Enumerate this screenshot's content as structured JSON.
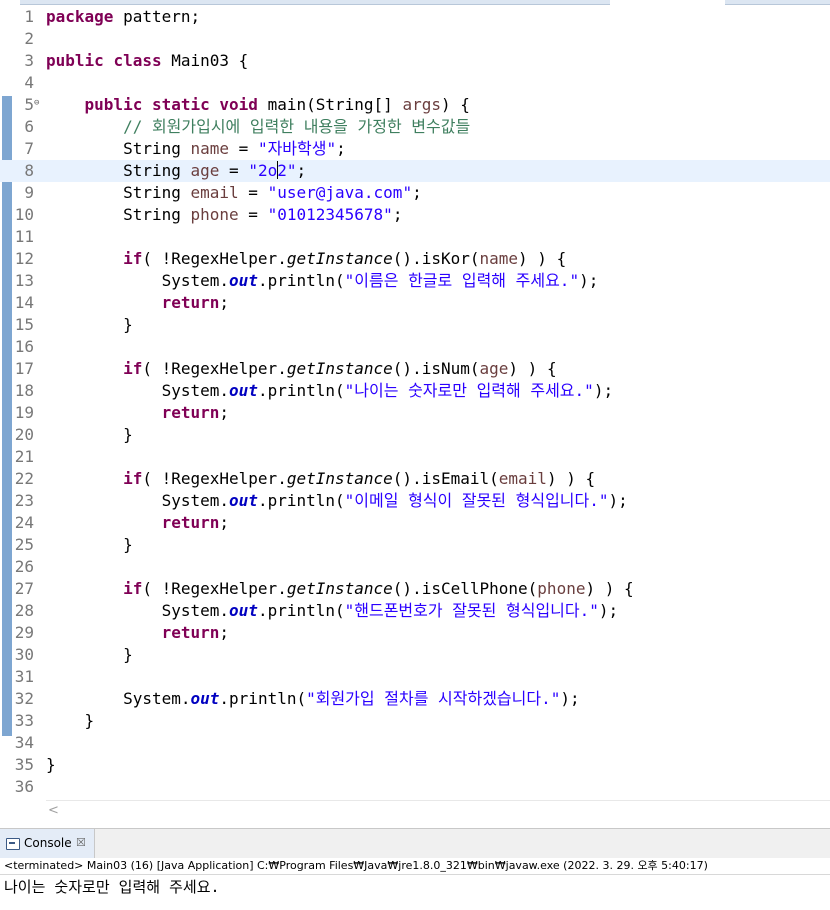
{
  "editor": {
    "current_line": 8,
    "lines": [
      {
        "n": "1",
        "tokens": [
          {
            "t": "package",
            "c": "kw"
          },
          {
            "t": " pattern;"
          }
        ]
      },
      {
        "n": "2",
        "tokens": []
      },
      {
        "n": "3",
        "tokens": [
          {
            "t": "public",
            "c": "kw"
          },
          {
            "t": " "
          },
          {
            "t": "class",
            "c": "kw"
          },
          {
            "t": " Main03 {"
          }
        ]
      },
      {
        "n": "4",
        "tokens": []
      },
      {
        "n": "5",
        "fold": "⊖",
        "tokens": [
          {
            "t": "    "
          },
          {
            "t": "public",
            "c": "kw"
          },
          {
            "t": " "
          },
          {
            "t": "static",
            "c": "kw"
          },
          {
            "t": " "
          },
          {
            "t": "void",
            "c": "kw"
          },
          {
            "t": " main(String[] "
          },
          {
            "t": "args",
            "c": "var"
          },
          {
            "t": ") {"
          }
        ]
      },
      {
        "n": "6",
        "tokens": [
          {
            "t": "        "
          },
          {
            "t": "// 회원가입시에 입력한 내용을 가정한 변수값들",
            "c": "cm"
          }
        ]
      },
      {
        "n": "7",
        "tokens": [
          {
            "t": "        String "
          },
          {
            "t": "name",
            "c": "var"
          },
          {
            "t": " = "
          },
          {
            "t": "\"자바학생\"",
            "c": "str"
          },
          {
            "t": ";"
          }
        ]
      },
      {
        "n": "8",
        "tokens": [
          {
            "t": "        String "
          },
          {
            "t": "age",
            "c": "var"
          },
          {
            "t": " = "
          },
          {
            "t": "\"2o",
            "c": "str"
          },
          {
            "t": "",
            "c": "caret"
          },
          {
            "t": "2\"",
            "c": "str"
          },
          {
            "t": ";"
          }
        ]
      },
      {
        "n": "9",
        "tokens": [
          {
            "t": "        String "
          },
          {
            "t": "email",
            "c": "var"
          },
          {
            "t": " = "
          },
          {
            "t": "\"user@java.com\"",
            "c": "str"
          },
          {
            "t": ";"
          }
        ]
      },
      {
        "n": "10",
        "tokens": [
          {
            "t": "        String "
          },
          {
            "t": "phone",
            "c": "var"
          },
          {
            "t": " = "
          },
          {
            "t": "\"01012345678\"",
            "c": "str"
          },
          {
            "t": ";"
          }
        ]
      },
      {
        "n": "11",
        "tokens": []
      },
      {
        "n": "12",
        "tokens": [
          {
            "t": "        "
          },
          {
            "t": "if",
            "c": "kw"
          },
          {
            "t": "( !RegexHelper."
          },
          {
            "t": "getInstance",
            "c": "st"
          },
          {
            "t": "().isKor("
          },
          {
            "t": "name",
            "c": "var"
          },
          {
            "t": ") ) {"
          }
        ]
      },
      {
        "n": "13",
        "tokens": [
          {
            "t": "            System."
          },
          {
            "t": "out",
            "c": "fld"
          },
          {
            "t": ".println("
          },
          {
            "t": "\"이름은 한글로 입력해 주세요.\"",
            "c": "str"
          },
          {
            "t": ");"
          }
        ]
      },
      {
        "n": "14",
        "tokens": [
          {
            "t": "            "
          },
          {
            "t": "return",
            "c": "kw"
          },
          {
            "t": ";"
          }
        ]
      },
      {
        "n": "15",
        "tokens": [
          {
            "t": "        }"
          }
        ]
      },
      {
        "n": "16",
        "tokens": []
      },
      {
        "n": "17",
        "tokens": [
          {
            "t": "        "
          },
          {
            "t": "if",
            "c": "kw"
          },
          {
            "t": "( !RegexHelper."
          },
          {
            "t": "getInstance",
            "c": "st"
          },
          {
            "t": "().isNum("
          },
          {
            "t": "age",
            "c": "var"
          },
          {
            "t": ") ) {"
          }
        ]
      },
      {
        "n": "18",
        "tokens": [
          {
            "t": "            System."
          },
          {
            "t": "out",
            "c": "fld"
          },
          {
            "t": ".println("
          },
          {
            "t": "\"나이는 숫자로만 입력해 주세요.\"",
            "c": "str"
          },
          {
            "t": ");"
          }
        ]
      },
      {
        "n": "19",
        "tokens": [
          {
            "t": "            "
          },
          {
            "t": "return",
            "c": "kw"
          },
          {
            "t": ";"
          }
        ]
      },
      {
        "n": "20",
        "tokens": [
          {
            "t": "        }"
          }
        ]
      },
      {
        "n": "21",
        "tokens": []
      },
      {
        "n": "22",
        "tokens": [
          {
            "t": "        "
          },
          {
            "t": "if",
            "c": "kw"
          },
          {
            "t": "( !RegexHelper."
          },
          {
            "t": "getInstance",
            "c": "st"
          },
          {
            "t": "().isEmail("
          },
          {
            "t": "email",
            "c": "var"
          },
          {
            "t": ") ) {"
          }
        ]
      },
      {
        "n": "23",
        "tokens": [
          {
            "t": "            System."
          },
          {
            "t": "out",
            "c": "fld"
          },
          {
            "t": ".println("
          },
          {
            "t": "\"이메일 형식이 잘못된 형식입니다.\"",
            "c": "str"
          },
          {
            "t": ");"
          }
        ]
      },
      {
        "n": "24",
        "tokens": [
          {
            "t": "            "
          },
          {
            "t": "return",
            "c": "kw"
          },
          {
            "t": ";"
          }
        ]
      },
      {
        "n": "25",
        "tokens": [
          {
            "t": "        }"
          }
        ]
      },
      {
        "n": "26",
        "tokens": []
      },
      {
        "n": "27",
        "tokens": [
          {
            "t": "        "
          },
          {
            "t": "if",
            "c": "kw"
          },
          {
            "t": "( !RegexHelper."
          },
          {
            "t": "getInstance",
            "c": "st"
          },
          {
            "t": "().isCellPhone("
          },
          {
            "t": "phone",
            "c": "var"
          },
          {
            "t": ") ) {"
          }
        ]
      },
      {
        "n": "28",
        "tokens": [
          {
            "t": "            System."
          },
          {
            "t": "out",
            "c": "fld"
          },
          {
            "t": ".println("
          },
          {
            "t": "\"핸드폰번호가 잘못된 형식입니다.\"",
            "c": "str"
          },
          {
            "t": ");"
          }
        ]
      },
      {
        "n": "29",
        "tokens": [
          {
            "t": "            "
          },
          {
            "t": "return",
            "c": "kw"
          },
          {
            "t": ";"
          }
        ]
      },
      {
        "n": "30",
        "tokens": [
          {
            "t": "        }"
          }
        ]
      },
      {
        "n": "31",
        "tokens": []
      },
      {
        "n": "32",
        "tokens": [
          {
            "t": "        System."
          },
          {
            "t": "out",
            "c": "fld"
          },
          {
            "t": ".println("
          },
          {
            "t": "\"회원가입 절차를 시작하겠습니다.\"",
            "c": "str"
          },
          {
            "t": ");"
          }
        ]
      },
      {
        "n": "33",
        "tokens": [
          {
            "t": "    }"
          }
        ]
      },
      {
        "n": "34",
        "tokens": []
      },
      {
        "n": "35",
        "tokens": [
          {
            "t": "}"
          }
        ]
      },
      {
        "n": "36",
        "tokens": []
      }
    ]
  },
  "scrollbar": {
    "left_arrow": "<"
  },
  "console": {
    "tab_label": "Console",
    "close_glyph": "☒",
    "status": "<terminated> Main03 (16) [Java Application] C:₩Program Files₩Java₩jre1.8.0_321₩bin₩javaw.exe  (2022. 3. 29. 오후 5:40:17)",
    "output": "나이는 숫자로만 입력해 주세요."
  },
  "colors": {
    "keyword": "#7f0055",
    "string": "#2a00ff",
    "comment": "#3f7f5f",
    "variable": "#6a3e3e",
    "field": "#0000c0",
    "current_line": "#e8f2fe"
  }
}
